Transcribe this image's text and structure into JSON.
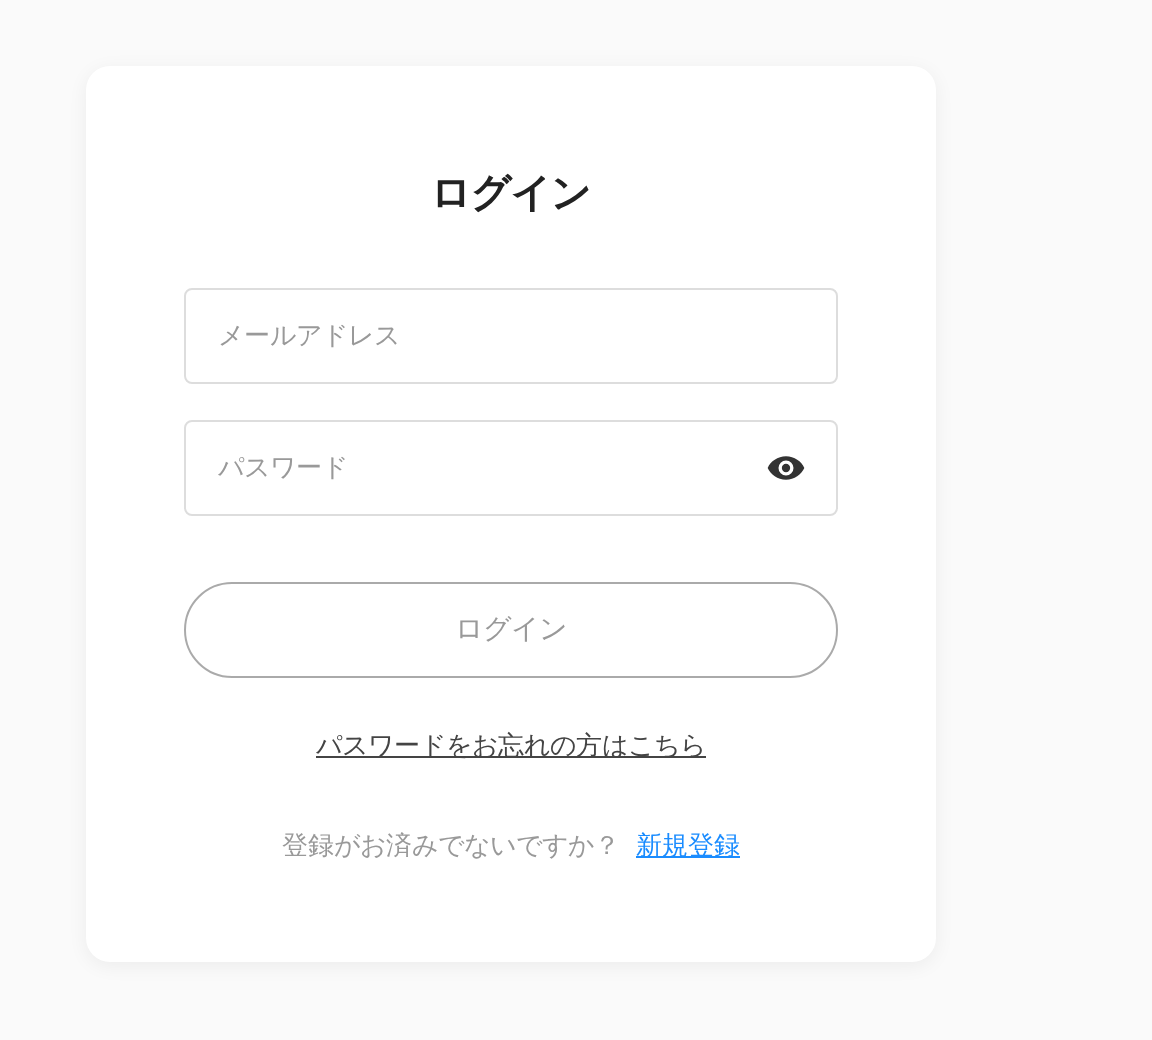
{
  "title": "ログイン",
  "fields": [
    {
      "placeholder": "メールアドレス",
      "kind": "email"
    },
    {
      "placeholder": "パスワード",
      "kind": "password"
    }
  ],
  "submit": {
    "label": "ログイン",
    "disabled": true
  },
  "forgot_link": "パスワードをお忘れの方はこちら",
  "signup": {
    "prompt": "登録がお済みでないですか？",
    "link": "新規登録"
  }
}
